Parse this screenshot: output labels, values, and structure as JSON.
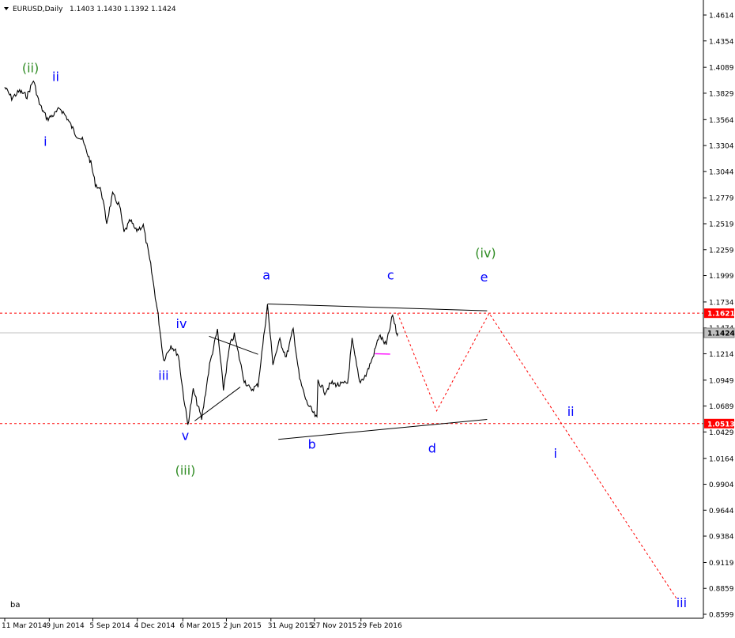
{
  "chart_data": {
    "type": "line",
    "header": {
      "symbol": "EURUSD,Daily",
      "ohlc": "1.1403 1.1430 1.1392 1.1424"
    },
    "footer_label": "ba",
    "y_range": [
      0.8599,
      1.4614
    ],
    "y_ticks": [
      "1.4614",
      "1.4354",
      "1.4089",
      "1.3829",
      "1.3564",
      "1.3304",
      "1.3044",
      "1.2779",
      "1.2519",
      "1.2259",
      "1.1999",
      "1.1734",
      "1.1474",
      "1.1214",
      "1.0949",
      "1.0689",
      "1.0429",
      "1.0164",
      "0.9904",
      "0.9644",
      "0.9384",
      "0.9119",
      "0.8859",
      "0.8599"
    ],
    "x_range": [
      "2014-03-11",
      "2017-12-01"
    ],
    "x_ticks": [
      {
        "date": "2014-03-11",
        "label": "11 Mar 2014"
      },
      {
        "date": "2014-06-09",
        "label": "9 Jun 2014"
      },
      {
        "date": "2014-09-05",
        "label": "5 Sep 2014"
      },
      {
        "date": "2014-12-04",
        "label": "4 Dec 2014"
      },
      {
        "date": "2015-03-06",
        "label": "6 Mar 2015"
      },
      {
        "date": "2015-06-02",
        "label": "2 Jun 2015"
      },
      {
        "date": "2015-08-31",
        "label": "31 Aug 2015"
      },
      {
        "date": "2015-11-27",
        "label": "27 Nov 2015"
      },
      {
        "date": "2016-02-29",
        "label": "29 Feb 2016"
      }
    ],
    "price_series": {
      "name": "EURUSD",
      "points": [
        [
          "2014-03-11",
          1.389
        ],
        [
          "2014-03-25",
          1.378
        ],
        [
          "2014-04-10",
          1.385
        ],
        [
          "2014-04-25",
          1.38
        ],
        [
          "2014-05-08",
          1.396
        ],
        [
          "2014-05-20",
          1.372
        ],
        [
          "2014-06-05",
          1.357
        ],
        [
          "2014-06-20",
          1.362
        ],
        [
          "2014-07-01",
          1.368
        ],
        [
          "2014-07-15",
          1.358
        ],
        [
          "2014-08-01",
          1.342
        ],
        [
          "2014-08-15",
          1.336
        ],
        [
          "2014-09-01",
          1.313
        ],
        [
          "2014-09-10",
          1.292
        ],
        [
          "2014-09-22",
          1.285
        ],
        [
          "2014-10-03",
          1.253
        ],
        [
          "2014-10-15",
          1.281
        ],
        [
          "2014-10-29",
          1.27
        ],
        [
          "2014-11-07",
          1.243
        ],
        [
          "2014-11-20",
          1.255
        ],
        [
          "2014-12-01",
          1.245
        ],
        [
          "2014-12-16",
          1.25
        ],
        [
          "2014-12-31",
          1.21
        ],
        [
          "2015-01-15",
          1.16
        ],
        [
          "2015-01-26",
          1.115
        ],
        [
          "2015-02-10",
          1.13
        ],
        [
          "2015-02-25",
          1.12
        ],
        [
          "2015-03-06",
          1.084
        ],
        [
          "2015-03-16",
          1.05
        ],
        [
          "2015-03-27",
          1.085
        ],
        [
          "2015-04-13",
          1.056
        ],
        [
          "2015-04-29",
          1.11
        ],
        [
          "2015-05-15",
          1.145
        ],
        [
          "2015-05-27",
          1.086
        ],
        [
          "2015-06-09",
          1.13
        ],
        [
          "2015-06-18",
          1.14
        ],
        [
          "2015-07-08",
          1.095
        ],
        [
          "2015-07-21",
          1.085
        ],
        [
          "2015-08-05",
          1.09
        ],
        [
          "2015-08-24",
          1.17
        ],
        [
          "2015-09-04",
          1.112
        ],
        [
          "2015-09-18",
          1.135
        ],
        [
          "2015-10-01",
          1.118
        ],
        [
          "2015-10-15",
          1.146
        ],
        [
          "2015-10-28",
          1.096
        ],
        [
          "2015-11-11",
          1.073
        ],
        [
          "2015-12-02",
          1.056
        ],
        [
          "2015-12-04",
          1.095
        ],
        [
          "2015-12-18",
          1.083
        ],
        [
          "2015-12-31",
          1.092
        ],
        [
          "2016-01-15",
          1.09
        ],
        [
          "2016-02-02",
          1.092
        ],
        [
          "2016-02-11",
          1.135
        ],
        [
          "2016-02-26",
          1.093
        ],
        [
          "2016-03-10",
          1.1
        ],
        [
          "2016-03-24",
          1.118
        ],
        [
          "2016-04-06",
          1.14
        ],
        [
          "2016-04-20",
          1.13
        ],
        [
          "2016-05-03",
          1.16
        ],
        [
          "2016-05-12",
          1.14
        ],
        [
          "2016-05-13",
          1.142
        ]
      ]
    },
    "horizontal_levels": [
      {
        "value": 1.1621,
        "label": "1.1621",
        "style": "dashed",
        "color": "#ff0000"
      },
      {
        "value": 1.0513,
        "label": "1.0513",
        "style": "dashed",
        "color": "#ff0000"
      },
      {
        "value": 1.1424,
        "label": "1.1424",
        "style": "solid",
        "color": "#c0c0c0"
      }
    ],
    "trend_lines": [
      {
        "from": [
          "2015-08-24",
          1.1714
        ],
        "to": [
          "2016-11-10",
          1.1645
        ],
        "color": "#000000"
      },
      {
        "from": [
          "2015-09-15",
          1.0355
        ],
        "to": [
          "2016-11-10",
          1.0555
        ],
        "color": "#000000"
      },
      {
        "from": [
          "2015-03-30",
          1.054
        ],
        "to": [
          "2015-06-30",
          1.088
        ],
        "color": "#000000"
      },
      {
        "from": [
          "2015-04-28",
          1.139
        ],
        "to": [
          "2015-08-05",
          1.1208
        ],
        "color": "#000000"
      },
      {
        "from": [
          "2016-03-28",
          1.1214
        ],
        "to": [
          "2016-04-28",
          1.121
        ],
        "color": "#ff00ff"
      }
    ],
    "projection_path": {
      "color": "#ff0000",
      "points": [
        [
          "2016-05-13",
          1.1621
        ],
        [
          "2016-07-31",
          1.064
        ],
        [
          "2016-11-14",
          1.1621
        ],
        [
          "2017-11-30",
          0.874
        ]
      ]
    },
    "wave_labels": [
      {
        "text": "(ii)",
        "x": "2014-05-02",
        "y": 1.404,
        "color": "#2e8b22"
      },
      {
        "text": "ii",
        "x": "2014-06-22",
        "y": 1.395,
        "color": "#0000ff"
      },
      {
        "text": "i",
        "x": "2014-06-01",
        "y": 1.33,
        "color": "#0000ff"
      },
      {
        "text": "iv",
        "x": "2015-03-03",
        "y": 1.147,
        "color": "#0000ff"
      },
      {
        "text": "iii",
        "x": "2015-01-26",
        "y": 1.095,
        "color": "#0000ff"
      },
      {
        "text": "v",
        "x": "2015-03-11",
        "y": 1.035,
        "color": "#0000ff"
      },
      {
        "text": "(iii)",
        "x": "2015-03-11",
        "y": 1.0,
        "color": "#2e8b22"
      },
      {
        "text": "a",
        "x": "2015-08-22",
        "y": 1.196,
        "color": "#0000ff"
      },
      {
        "text": "b",
        "x": "2015-11-22",
        "y": 1.026,
        "color": "#0000ff"
      },
      {
        "text": "c",
        "x": "2016-04-29",
        "y": 1.196,
        "color": "#0000ff"
      },
      {
        "text": "d",
        "x": "2016-07-22",
        "y": 1.022,
        "color": "#0000ff"
      },
      {
        "text": "(iv)",
        "x": "2016-11-07",
        "y": 1.218,
        "color": "#2e8b22"
      },
      {
        "text": "e",
        "x": "2016-11-04",
        "y": 1.194,
        "color": "#0000ff"
      },
      {
        "text": "ii",
        "x": "2017-04-28",
        "y": 1.059,
        "color": "#0000ff"
      },
      {
        "text": "i",
        "x": "2017-03-28",
        "y": 1.017,
        "color": "#0000ff"
      },
      {
        "text": "iii",
        "x": "2017-12-08",
        "y": 0.867,
        "color": "#0000ff"
      }
    ],
    "grid": false,
    "legend": "none"
  }
}
